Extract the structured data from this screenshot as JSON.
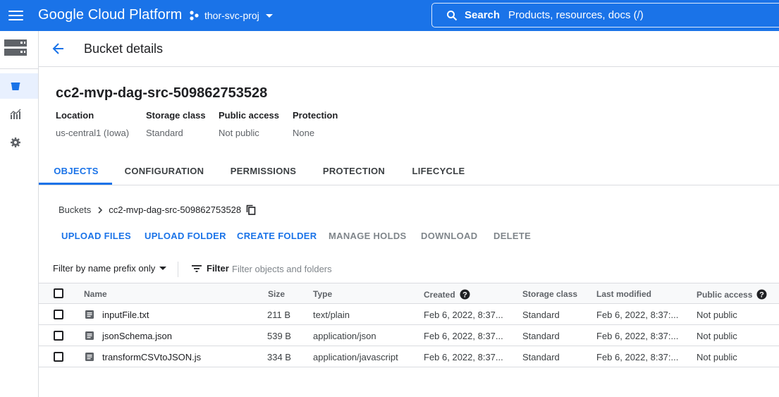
{
  "topbar": {
    "brand": "Google Cloud Platform",
    "project": "thor-svc-proj",
    "search_label": "Search",
    "search_placeholder": "Products, resources, docs (/)"
  },
  "header": {
    "title": "Bucket details"
  },
  "bucket": {
    "name": "cc2-mvp-dag-src-509862753528",
    "meta": [
      {
        "label": "Location",
        "value": "us-central1 (Iowa)"
      },
      {
        "label": "Storage class",
        "value": "Standard"
      },
      {
        "label": "Public access",
        "value": "Not public"
      },
      {
        "label": "Protection",
        "value": "None"
      }
    ]
  },
  "tabs": [
    "OBJECTS",
    "CONFIGURATION",
    "PERMISSIONS",
    "PROTECTION",
    "LIFECYCLE"
  ],
  "breadcrumb": {
    "root": "Buckets",
    "current": "cc2-mvp-dag-src-509862753528"
  },
  "actions": [
    "UPLOAD FILES",
    "UPLOAD FOLDER",
    "CREATE FOLDER",
    "MANAGE HOLDS",
    "DOWNLOAD",
    "DELETE"
  ],
  "filter": {
    "select_value": "Filter by name prefix only",
    "button": "Filter",
    "placeholder": "Filter objects and folders"
  },
  "table": {
    "headers": [
      "Name",
      "Size",
      "Type",
      "Created",
      "Storage class",
      "Last modified",
      "Public access"
    ],
    "rows": [
      [
        "inputFile.txt",
        "211 B",
        "text/plain",
        "Feb 6, 2022, 8:37...",
        "Standard",
        "Feb 6, 2022, 8:37:...",
        "Not public"
      ],
      [
        "jsonSchema.json",
        "539 B",
        "application/json",
        "Feb 6, 2022, 8:37...",
        "Standard",
        "Feb 6, 2022, 8:37:...",
        "Not public"
      ],
      [
        "transformCSVtoJSON.js",
        "334 B",
        "application/javascript",
        "Feb 6, 2022, 8:37...",
        "Standard",
        "Feb 6, 2022, 8:37:...",
        "Not public"
      ]
    ]
  },
  "colors": {
    "accent": "#1a73e8",
    "disabled": "#80868b"
  },
  "icons": [
    "menu-icon",
    "project-icon",
    "search-icon",
    "storage-logo-icon",
    "bucket-icon",
    "monitoring-icon",
    "settings-icon",
    "back-arrow-icon",
    "chevron-right-icon",
    "copy-icon",
    "filter-icon",
    "help-icon",
    "file-icon"
  ]
}
